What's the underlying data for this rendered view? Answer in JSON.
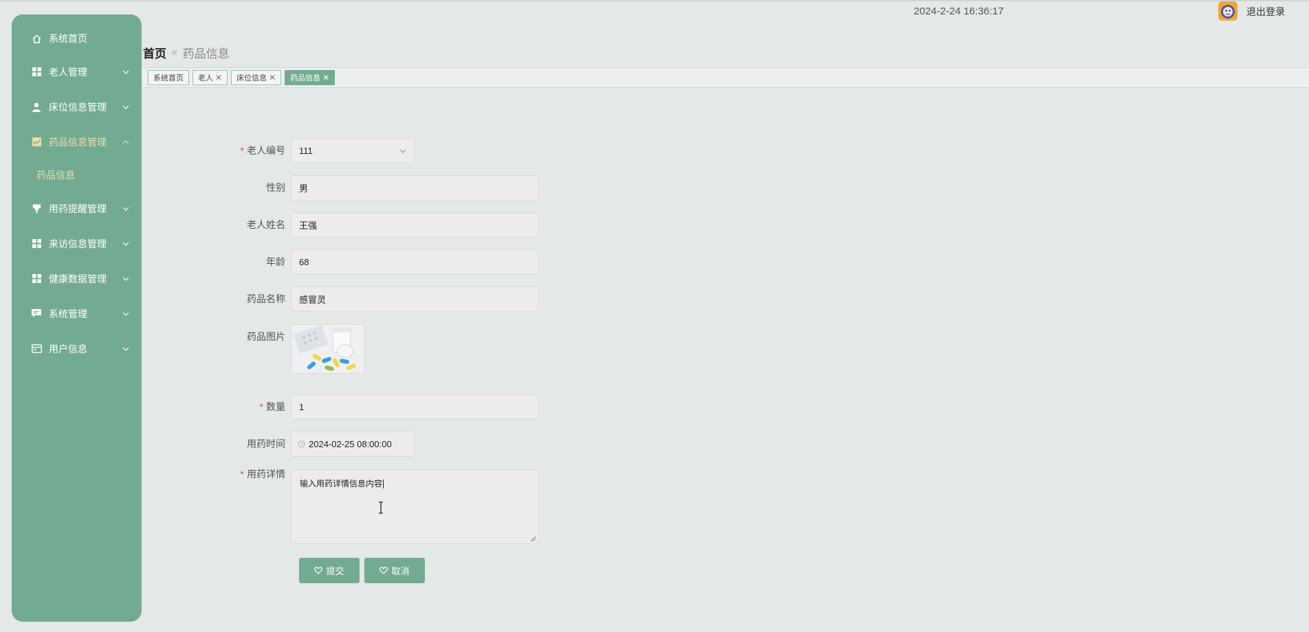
{
  "header": {
    "datetime": "2024-2-24 16:36:17",
    "logout_label": "退出登录"
  },
  "sidebar": {
    "items": [
      {
        "label": "系统首页",
        "icon": "home-icon"
      },
      {
        "label": "老人管理",
        "icon": "grid-icon"
      },
      {
        "label": "床位信息管理",
        "icon": "user-icon"
      },
      {
        "label": "药品信息管理",
        "icon": "chart-icon"
      },
      {
        "label": "用药提醒管理",
        "icon": "pin-icon"
      },
      {
        "label": "来访信息管理",
        "icon": "grid-icon"
      },
      {
        "label": "健康数据管理",
        "icon": "grid-icon"
      },
      {
        "label": "系统管理",
        "icon": "chat-icon"
      },
      {
        "label": "用户信息",
        "icon": "card-icon"
      }
    ],
    "sub_item": "药品信息"
  },
  "breadcrumb": {
    "home": "首页",
    "current": "药品信息"
  },
  "tabs": [
    {
      "label": "系统首页"
    },
    {
      "label": "老人"
    },
    {
      "label": "床位信息"
    },
    {
      "label": "药品信息"
    }
  ],
  "form": {
    "elder_id_label": "老人编号",
    "elder_id_value": "111",
    "gender_label": "性别",
    "gender_value": "男",
    "name_label": "老人姓名",
    "name_value": "王强",
    "age_label": "年龄",
    "age_value": "68",
    "drug_name_label": "药品名称",
    "drug_name_value": "感冒灵",
    "drug_image_label": "药品图片",
    "quantity_label": "数量",
    "quantity_value": "1",
    "time_label": "用药时间",
    "time_value": "2024-02-25 08:00:00",
    "detail_label": "用药详情",
    "detail_value": "输入用药详情信息内容"
  },
  "buttons": {
    "submit": "提交",
    "cancel": "取消"
  },
  "colors": {
    "accent": "#73ab92",
    "active_text": "#e9dca4",
    "required": "#e04b4b",
    "background": "#e4e8e7"
  }
}
